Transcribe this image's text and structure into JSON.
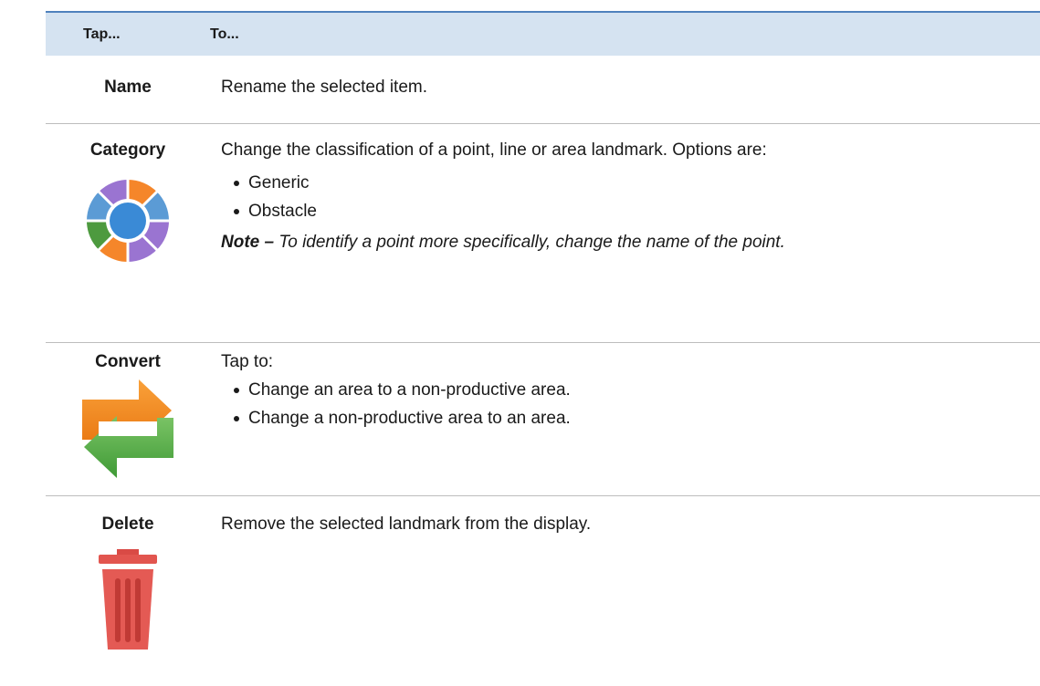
{
  "header": {
    "col1": "Tap...",
    "col2": "To..."
  },
  "rows": [
    {
      "tap": "Name",
      "text": "Rename the selected item."
    },
    {
      "tap": "Category",
      "text": "Change the classification of a point, line or area landmark. Options are:",
      "bullets": [
        "Generic",
        "Obstacle"
      ],
      "note_label": "Note –",
      "note_text": " To identify a point more specifically, change the name of the point.",
      "icon": "category-wheel-icon"
    },
    {
      "tap": "Convert",
      "text": "Tap to:",
      "bullets": [
        "Change an area to a non-productive area.",
        "Change a non-productive area to an area."
      ],
      "icon": "convert-arrows-icon"
    },
    {
      "tap": "Delete",
      "text": "Remove the selected landmark from the display.",
      "icon": "trash-icon"
    }
  ],
  "colors": {
    "header_bg": "#d5e3f1",
    "header_rule": "#4f81bd",
    "row_rule": "#bdbdbd"
  }
}
